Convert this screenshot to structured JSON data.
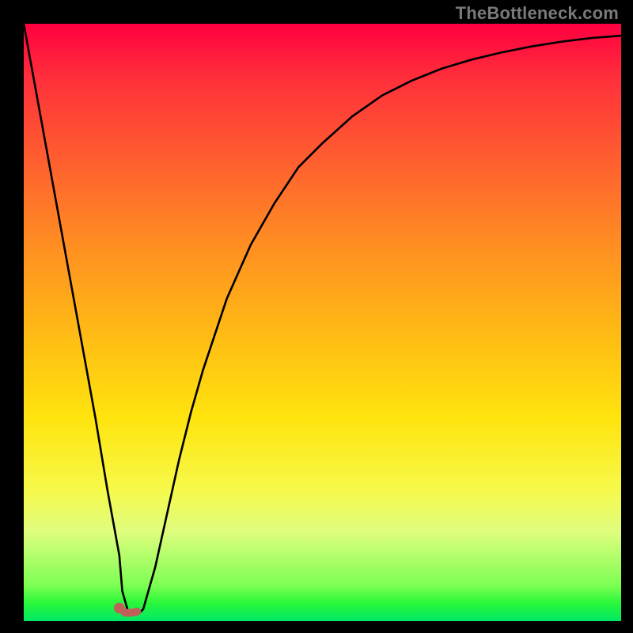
{
  "watermark": "TheBottleneck.com",
  "colors": {
    "frame_bg": "#000000",
    "watermark": "#7a7a7a",
    "curve_stroke": "#000000",
    "segment_stroke": "#c06058",
    "segment_dot": "#c06058",
    "gradient_stops": [
      "#ff0040",
      "#ff2f3b",
      "#ff5532",
      "#ff8b23",
      "#ffb516",
      "#ffe40e",
      "#f6f94a",
      "#e0fd7f",
      "#7dff53",
      "#29f73a",
      "#00e865"
    ]
  },
  "chart_data": {
    "type": "line",
    "title": "",
    "xlabel": "",
    "ylabel": "",
    "xlim": [
      0,
      100
    ],
    "ylim": [
      0,
      100
    ],
    "grid": false,
    "legend": false,
    "series": [
      {
        "name": "bottleneck-curve",
        "x": [
          0,
          2,
          4,
          6,
          8,
          10,
          12,
          14,
          16,
          16.5,
          17.5,
          18.5,
          19.5,
          20,
          22,
          24,
          26,
          28,
          30,
          34,
          38,
          42,
          46,
          50,
          55,
          60,
          65,
          70,
          75,
          80,
          85,
          90,
          95,
          100
        ],
        "y": [
          100,
          89,
          78,
          67,
          56,
          45,
          34,
          22,
          11,
          5,
          1.5,
          1.5,
          1.5,
          2,
          9,
          18,
          27,
          35,
          42,
          54,
          63,
          70,
          76,
          80,
          84.5,
          88,
          90.5,
          92.5,
          94,
          95.2,
          96.2,
          97,
          97.6,
          98
        ]
      }
    ],
    "highlight_segment": {
      "name": "optimal-zone",
      "x": [
        16,
        17,
        18,
        19
      ],
      "y": [
        2.2,
        1.4,
        1.4,
        1.6
      ],
      "dot": {
        "x": 16,
        "y": 2.2
      }
    }
  }
}
